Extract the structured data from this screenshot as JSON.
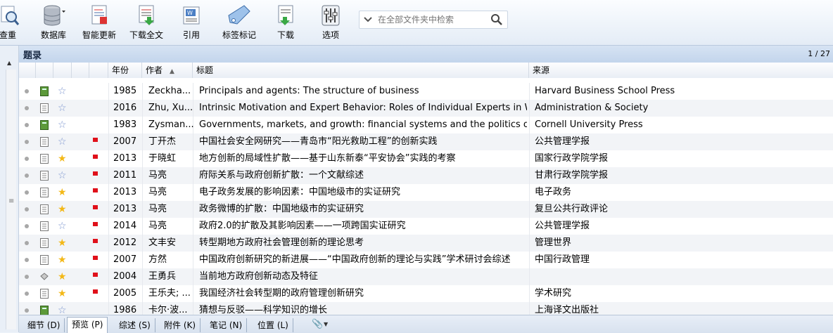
{
  "toolbar": {
    "buttons": [
      {
        "id": "query",
        "label": "查重",
        "icon": "magnifier-icon"
      },
      {
        "id": "database",
        "label": "数据库",
        "icon": "database-icon"
      },
      {
        "id": "smart-update",
        "label": "智能更新",
        "icon": "smart-update-icon"
      },
      {
        "id": "download-fulltext",
        "label": "下载全文",
        "icon": "download-fulltext-icon"
      },
      {
        "id": "cite",
        "label": "引用",
        "icon": "cite-icon"
      },
      {
        "id": "tag",
        "label": "标签标记",
        "icon": "tag-icon"
      },
      {
        "id": "download",
        "label": "下载",
        "icon": "download-icon"
      },
      {
        "id": "options",
        "label": "选项",
        "icon": "sliders-icon"
      }
    ],
    "search_placeholder": "在全部文件夹中检索"
  },
  "pane": {
    "title": "题录",
    "count": "1 / 27"
  },
  "columns": {
    "year": "年份",
    "author": "作者",
    "title": "标题",
    "source": "来源"
  },
  "rows": [
    {
      "type": "book",
      "starred": false,
      "flag": false,
      "year": "1985",
      "author": "Zeckha...",
      "title": "Principals and agents: The structure of business",
      "source": "Harvard Business School Press"
    },
    {
      "type": "article",
      "starred": false,
      "flag": false,
      "year": "2016",
      "author": "Zhu, Xu...",
      "title": "Intrinsic Motivation and Expert Behavior: Roles of Individual Experts in We...",
      "source": "Administration & Society"
    },
    {
      "type": "book",
      "starred": false,
      "flag": false,
      "year": "1983",
      "author": "Zysman...",
      "title": "Governments, markets, and growth: financial systems and the politics of i...",
      "source": "Cornell University Press"
    },
    {
      "type": "article",
      "starred": false,
      "flag": true,
      "year": "2007",
      "author": "丁开杰",
      "title": "中国社会安全网研究——青岛市“阳光救助工程”的创新实践",
      "source": "公共管理学报"
    },
    {
      "type": "article",
      "starred": true,
      "flag": true,
      "year": "2013",
      "author": "于晓虹",
      "title": "地方创新的局域性扩散——基于山东新泰“平安协会”实践的考察",
      "source": "国家行政学院学报"
    },
    {
      "type": "article",
      "starred": false,
      "flag": true,
      "year": "2011",
      "author": "马亮",
      "title": "府际关系与政府创新扩散：一个文献综述",
      "source": "甘肃行政学院学报"
    },
    {
      "type": "article",
      "starred": true,
      "flag": true,
      "year": "2013",
      "author": "马亮",
      "title": "电子政务发展的影响因素：中国地级市的实证研究",
      "source": "电子政务"
    },
    {
      "type": "article",
      "starred": true,
      "flag": true,
      "year": "2013",
      "author": "马亮",
      "title": "政务微博的扩散：中国地级市的实证研究",
      "source": "复旦公共行政评论"
    },
    {
      "type": "article",
      "starred": false,
      "flag": true,
      "year": "2014",
      "author": "马亮",
      "title": "政府2.0的扩散及其影响因素——一项跨国实证研究",
      "source": "公共管理学报"
    },
    {
      "type": "article",
      "starred": true,
      "flag": true,
      "year": "2012",
      "author": "文丰安",
      "title": "转型期地方政府社会管理创新的理论思考",
      "source": "管理世界"
    },
    {
      "type": "article",
      "starred": true,
      "flag": true,
      "year": "2007",
      "author": "方然",
      "title": "中国政府创新研究的新进展——“中国政府创新的理论与实践”学术研讨会综述",
      "source": "中国行政管理"
    },
    {
      "type": "conference",
      "starred": true,
      "flag": true,
      "year": "2004",
      "author": "王勇兵",
      "title": "当前地方政府创新动态及特征",
      "source": ""
    },
    {
      "type": "article",
      "starred": true,
      "flag": true,
      "year": "2005",
      "author": "王乐夫; ...",
      "title": "我国经济社会转型期的政府管理创新研究",
      "source": "学术研究"
    },
    {
      "type": "book",
      "starred": false,
      "flag": false,
      "year": "1986",
      "author": "卡尔·波...",
      "title": "猜想与反驳——科学知识的增长",
      "source": "上海译文出版社"
    }
  ],
  "tabs": [
    {
      "label": "细节 (D)",
      "active": false
    },
    {
      "label": "预览 (P)",
      "active": true
    },
    {
      "label": "综述 (S)",
      "active": false
    },
    {
      "label": "附件 (K)",
      "active": false
    },
    {
      "label": "笔记 (N)",
      "active": false
    },
    {
      "label": "位置 (L)",
      "active": false
    }
  ]
}
